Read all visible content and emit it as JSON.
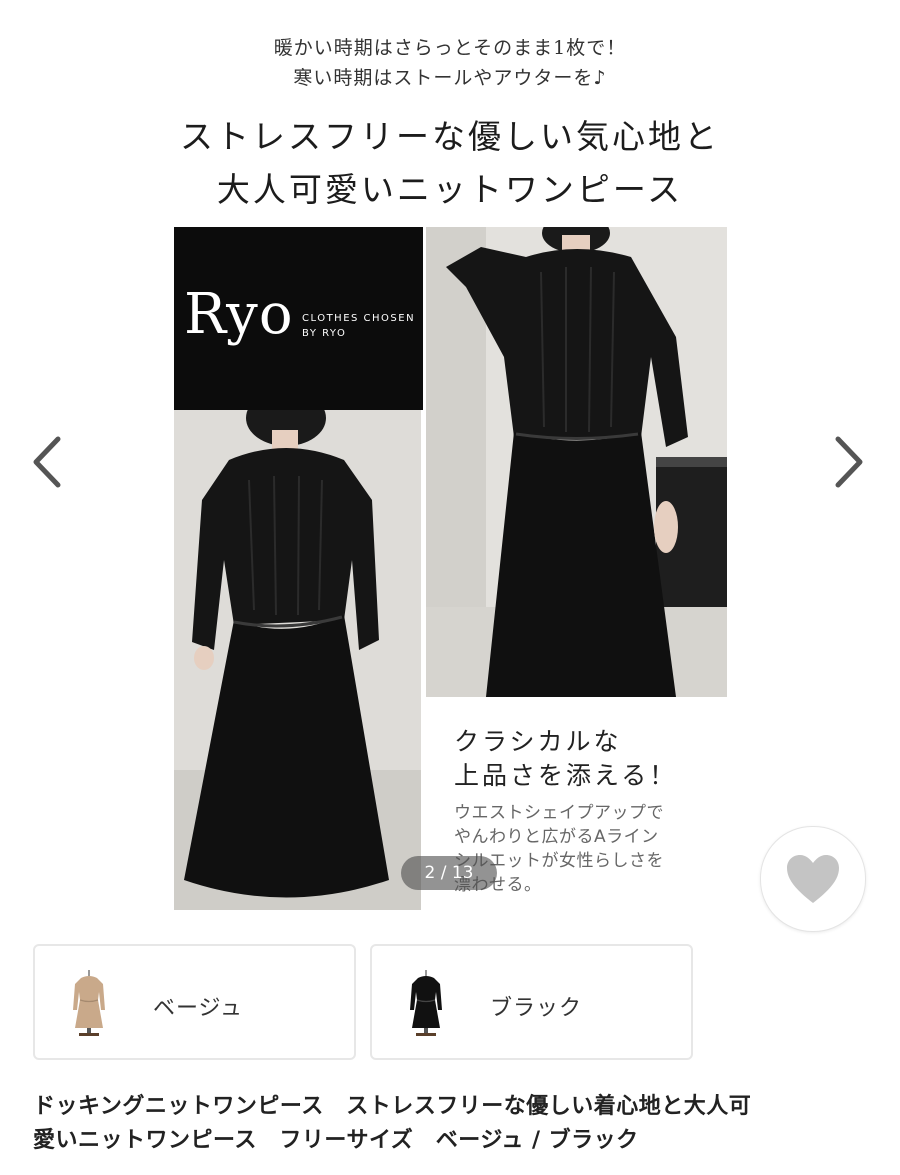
{
  "gallery": {
    "lead_line_1": "暖かい時期はさらっとそのまま1枚で！",
    "lead_line_2": "寒い時期はストールやアウターを♪",
    "headline_line_1": "ストレスフリーな優しい気心地と",
    "headline_line_2": "大人可愛いニットワンピース",
    "brand_name": "Ryo",
    "brand_sub_line_1": "CLOTHES CHOSEN",
    "brand_sub_line_2": "BY RYO",
    "copy_title": "クラシカルな\n上品さを添える！",
    "copy_body": "ウエストシェイプアップで\nやんわりと広がるAライン\nシルエットが女性らしさを\n漂わせる。",
    "counter": "2 / 13",
    "prev_icon": "chevron-left-icon",
    "next_icon": "chevron-right-icon"
  },
  "favorite": {
    "icon": "heart-icon",
    "color": "#c4c4c4"
  },
  "variants": [
    {
      "label": "ベージュ",
      "color": "#c9a98a"
    },
    {
      "label": "ブラック",
      "color": "#111111"
    }
  ],
  "product": {
    "title": "ドッキングニットワンピース　ストレスフリーな優しい着心地と大人可\n愛いニットワンピース　フリーサイズ　ベージュ / ブラック"
  }
}
